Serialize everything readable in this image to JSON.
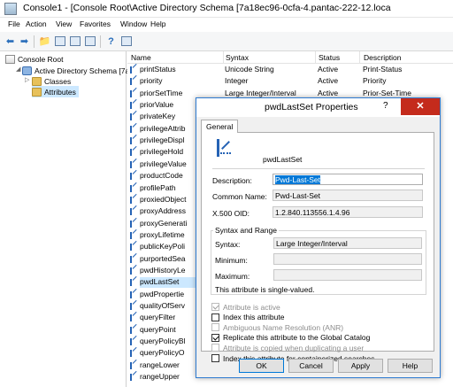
{
  "window": {
    "title": "Console1 - [Console Root\\Active Directory Schema [7a18ec96-0cfa-4.pantac-222-12.loca"
  },
  "menu": [
    "File",
    "Action",
    "View",
    "Favorites",
    "Window",
    "Help"
  ],
  "toolbar": {
    "icons": [
      "back-icon",
      "forward-icon",
      "up-folder-icon",
      "show-hide-tree-icon",
      "refresh-icon",
      "export-list-icon",
      "help-icon",
      "properties-icon"
    ]
  },
  "tree": {
    "root": "Console Root",
    "schema": "Active Directory Schema [7a",
    "classes": "Classes",
    "attributes": "Attributes"
  },
  "list": {
    "columns": [
      "Name",
      "Syntax",
      "Status",
      "Description"
    ],
    "rows": [
      {
        "name": "printStatus",
        "syntax": "Unicode String",
        "status": "Active",
        "description": "Print-Status"
      },
      {
        "name": "priority",
        "syntax": "Integer",
        "status": "Active",
        "description": "Priority"
      },
      {
        "name": "priorSetTime",
        "syntax": "Large Integer/Interval",
        "status": "Active",
        "description": "Prior-Set-Time"
      },
      {
        "name": "priorValue",
        "syntax": "",
        "status": "",
        "description": ""
      },
      {
        "name": "privateKey",
        "syntax": "",
        "status": "",
        "description": ""
      },
      {
        "name": "privilegeAttrib",
        "syntax": "",
        "status": "",
        "description": ""
      },
      {
        "name": "privilegeDispl",
        "syntax": "",
        "status": "",
        "description": ""
      },
      {
        "name": "privilegeHold",
        "syntax": "",
        "status": "",
        "description": ""
      },
      {
        "name": "privilegeValue",
        "syntax": "",
        "status": "",
        "description": ""
      },
      {
        "name": "productCode",
        "syntax": "",
        "status": "",
        "description": ""
      },
      {
        "name": "profilePath",
        "syntax": "",
        "status": "",
        "description": ""
      },
      {
        "name": "proxiedObject",
        "syntax": "",
        "status": "",
        "description": ""
      },
      {
        "name": "proxyAddress",
        "syntax": "",
        "status": "",
        "description": ""
      },
      {
        "name": "proxyGenerati",
        "syntax": "",
        "status": "",
        "description": ""
      },
      {
        "name": "proxyLifetime",
        "syntax": "",
        "status": "",
        "description": ""
      },
      {
        "name": "publicKeyPoli",
        "syntax": "",
        "status": "",
        "description": ""
      },
      {
        "name": "purportedSea",
        "syntax": "",
        "status": "",
        "description": ""
      },
      {
        "name": "pwdHistoryLe",
        "syntax": "",
        "status": "",
        "description": ""
      },
      {
        "name": "pwdLastSet",
        "syntax": "",
        "status": "",
        "description": ""
      },
      {
        "name": "pwdPropertie",
        "syntax": "",
        "status": "",
        "description": ""
      },
      {
        "name": "qualityOfServ",
        "syntax": "",
        "status": "",
        "description": ""
      },
      {
        "name": "queryFilter",
        "syntax": "",
        "status": "",
        "description": ""
      },
      {
        "name": "queryPoint",
        "syntax": "",
        "status": "",
        "description": ""
      },
      {
        "name": "queryPolicyBl",
        "syntax": "",
        "status": "",
        "description": ""
      },
      {
        "name": "queryPolicyO",
        "syntax": "",
        "status": "",
        "description": ""
      },
      {
        "name": "rangeLower",
        "syntax": "",
        "status": "",
        "description": ""
      },
      {
        "name": "rangeUpper",
        "syntax": "",
        "status": "",
        "description": ""
      }
    ]
  },
  "dialog": {
    "title": "pwdLastSet Properties",
    "help_glyph": "?",
    "close_glyph": "✕",
    "tab": "General",
    "attribute_name": "pwdLastSet",
    "description_label": "Description:",
    "description_value": "Pwd-Last-Set",
    "common_name_label": "Common Name:",
    "common_name_value": "Pwd-Last-Set",
    "oid_label": "X.500 OID:",
    "oid_value": "1.2.840.113556.1.4.96",
    "syntax_group": "Syntax and Range",
    "syntax_label": "Syntax:",
    "syntax_value": "Large Integer/Interval",
    "min_label": "Minimum:",
    "min_value": "",
    "max_label": "Maximum:",
    "max_value": "",
    "single_valued": "This attribute is single-valued.",
    "options": [
      {
        "label": "Attribute is active",
        "checked": true,
        "disabled": true
      },
      {
        "label": "Index this attribute",
        "checked": false,
        "disabled": false
      },
      {
        "label": "Ambiguous Name Resolution (ANR)",
        "checked": false,
        "disabled": true
      },
      {
        "label": "Replicate this attribute to the Global Catalog",
        "checked": true,
        "disabled": false
      },
      {
        "label": "Attribute is copied when duplicating a user",
        "checked": false,
        "disabled": true
      },
      {
        "label": "Index this attribute for containerized searches",
        "checked": false,
        "disabled": false
      }
    ],
    "buttons": {
      "ok": "OK",
      "cancel": "Cancel",
      "apply": "Apply",
      "help": "Help"
    }
  }
}
